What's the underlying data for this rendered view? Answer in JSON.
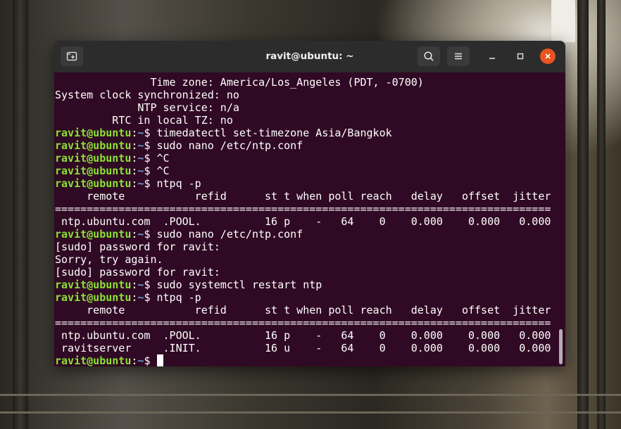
{
  "window": {
    "title": "ravit@ubuntu: ~"
  },
  "icons": {
    "new_tab": "new-tab-icon",
    "search": "search-icon",
    "menu": "hamburger-menu-icon",
    "minimize": "minimize-icon",
    "maximize": "maximize-icon",
    "close": "close-icon"
  },
  "colors": {
    "terminal_bg": "#300a24",
    "prompt_user": "#8ae234",
    "prompt_path": "#729fcf",
    "close_button": "#e95420"
  },
  "terminal": {
    "prompt": {
      "user": "ravit@ubuntu",
      "sep": ":",
      "path": "~",
      "symbol": "$"
    },
    "lines": [
      {
        "type": "out",
        "text": "               Time zone: America/Los_Angeles (PDT, -0700)"
      },
      {
        "type": "out",
        "text": "System clock synchronized: no"
      },
      {
        "type": "out",
        "text": "             NTP service: n/a"
      },
      {
        "type": "out",
        "text": "         RTC in local TZ: no"
      },
      {
        "type": "cmd",
        "text": " timedatectl set-timezone Asia/Bangkok"
      },
      {
        "type": "cmd",
        "text": " sudo nano /etc/ntp.conf"
      },
      {
        "type": "cmd",
        "text": " ^C"
      },
      {
        "type": "cmd",
        "text": " ^C"
      },
      {
        "type": "cmd",
        "text": " ntpq -p"
      },
      {
        "type": "out",
        "text": "     remote           refid      st t when poll reach   delay   offset  jitter"
      },
      {
        "type": "out",
        "text": "=============================================================================="
      },
      {
        "type": "out",
        "text": " ntp.ubuntu.com  .POOL.          16 p    -   64    0    0.000    0.000   0.000"
      },
      {
        "type": "cmd",
        "text": " sudo nano /etc/ntp.conf"
      },
      {
        "type": "out",
        "text": "[sudo] password for ravit:"
      },
      {
        "type": "out",
        "text": "Sorry, try again."
      },
      {
        "type": "out",
        "text": "[sudo] password for ravit:"
      },
      {
        "type": "cmd",
        "text": " sudo systemctl restart ntp"
      },
      {
        "type": "cmd",
        "text": " ntpq -p"
      },
      {
        "type": "out",
        "text": "     remote           refid      st t when poll reach   delay   offset  jitter"
      },
      {
        "type": "out",
        "text": "=============================================================================="
      },
      {
        "type": "out",
        "text": " ntp.ubuntu.com  .POOL.          16 p    -   64    0    0.000    0.000   0.000"
      },
      {
        "type": "out",
        "text": " ravitserver     .INIT.          16 u    -   64    0    0.000    0.000   0.000"
      },
      {
        "type": "cmd",
        "text": " ",
        "cursor": true
      }
    ]
  }
}
